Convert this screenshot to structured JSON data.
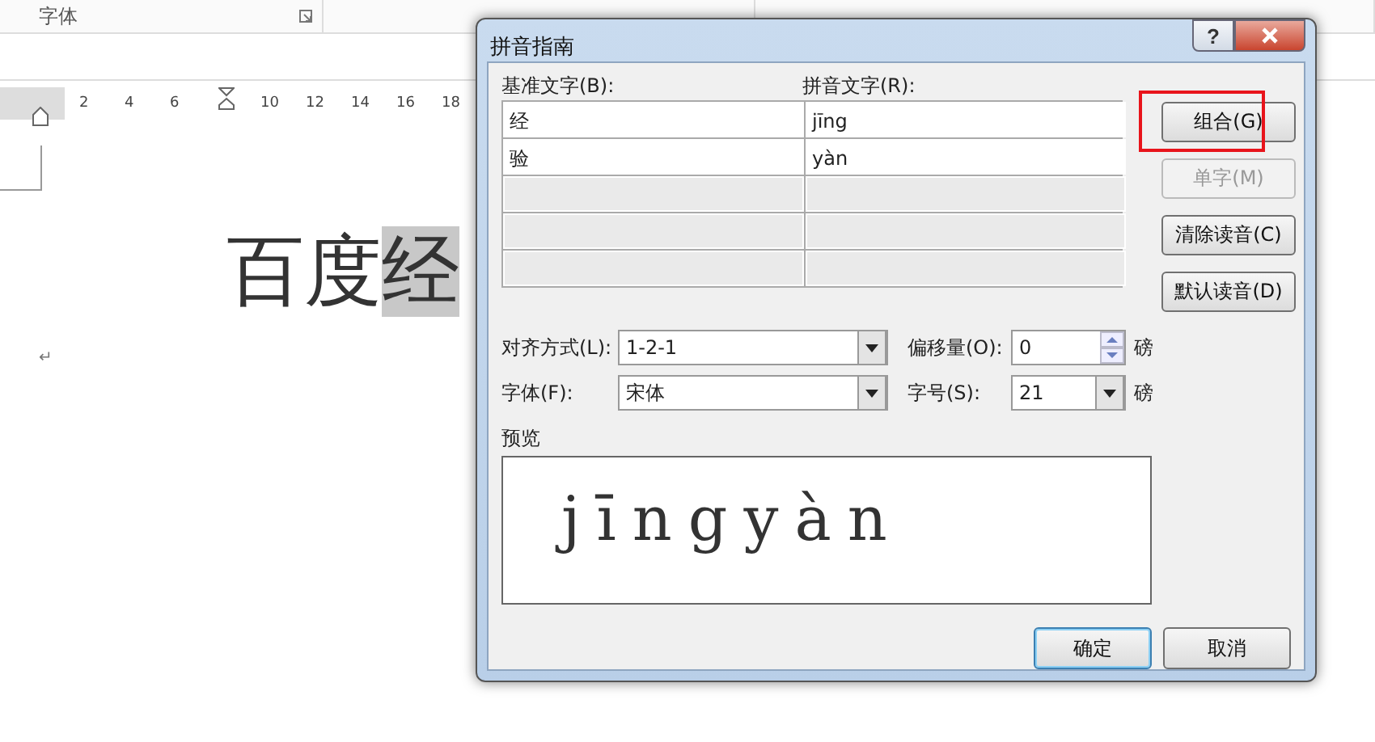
{
  "ribbon": {
    "group_label": "字体"
  },
  "ruler": {
    "ticks": [
      {
        "kind": "number",
        "label": "2"
      },
      {
        "kind": "number",
        "label": "4"
      },
      {
        "kind": "number",
        "label": "6"
      },
      {
        "kind": "marker"
      },
      {
        "kind": "number",
        "label": "10"
      },
      {
        "kind": "number",
        "label": "12"
      },
      {
        "kind": "number",
        "label": "14"
      },
      {
        "kind": "number",
        "label": "16"
      },
      {
        "kind": "number",
        "label": "18"
      }
    ]
  },
  "document": {
    "text": "百度",
    "selected_text": "经",
    "return_mark": "↵"
  },
  "dialog": {
    "title": "拼音指南",
    "help": "?",
    "table": {
      "columns": [
        "基准文字(B):",
        "拼音文字(R):"
      ],
      "rows": [
        [
          "经",
          "jīng"
        ],
        [
          "验",
          "yàn"
        ]
      ]
    },
    "side_buttons": [
      {
        "label": "组合(G)",
        "disabled": false,
        "highlighted": true
      },
      {
        "label": "单字(M)",
        "disabled": true,
        "highlighted": false
      },
      {
        "label": "清除读音(C)",
        "disabled": false,
        "highlighted": false
      },
      {
        "label": "默认读音(D)",
        "disabled": false,
        "highlighted": false
      }
    ],
    "options": [
      {
        "label": "对齐方式(L):",
        "kind": "combo",
        "value": "1-2-1"
      },
      {
        "label": "偏移量(O):",
        "kind": "spinner",
        "value": "0",
        "unit": "磅"
      },
      {
        "label": "字体(F):",
        "kind": "combo",
        "value": "宋体"
      },
      {
        "label": "字号(S):",
        "kind": "combo",
        "value": "21",
        "unit": "磅"
      }
    ],
    "preview": {
      "label": "预览",
      "pinyin": "jīngyàn"
    },
    "footer_buttons": [
      {
        "label": "确定",
        "default": true
      },
      {
        "label": "取消",
        "default": false
      }
    ]
  }
}
